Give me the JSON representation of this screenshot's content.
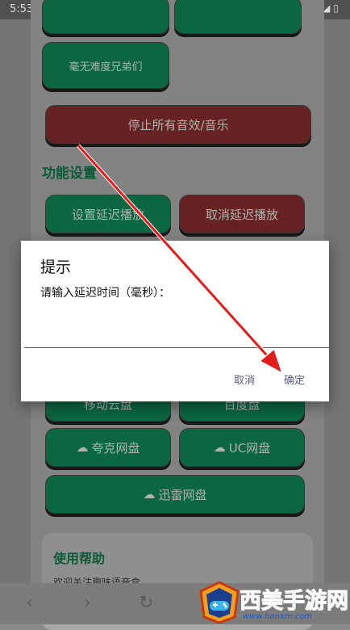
{
  "status_bar": {
    "time": "5:53",
    "icons": "▾◢▯"
  },
  "buttons": {
    "top_left": "",
    "top_right": "",
    "no_difficulty": "毫无难度兄弟们",
    "stop_all": "停止所有音效/音乐",
    "set_delay": "设置延迟播放",
    "cancel_delay": "取消延迟播放",
    "mobile_cloud": "移动云盘",
    "baidu": "百度盘",
    "quark": "夸克网盘",
    "uc": "UC网盘",
    "xunlei": "迅雷网盘"
  },
  "sections": {
    "function_settings": "功能设置",
    "help": "使用帮助",
    "help_text": "欢迎关注趣味语音盒"
  },
  "dialog": {
    "title": "提示",
    "message": "请输入延迟时间（毫秒）：",
    "input_value": "",
    "cancel": "取消",
    "ok": "确定"
  },
  "nav": {
    "back": "‹",
    "forward": "›",
    "refresh": "↻"
  },
  "watermark": {
    "brand": "西美手游网",
    "url": "www.hanxm.com"
  },
  "colors": {
    "green": "#0e7a4e",
    "red": "#7a2a2a",
    "arrow": "#e21b1b"
  }
}
